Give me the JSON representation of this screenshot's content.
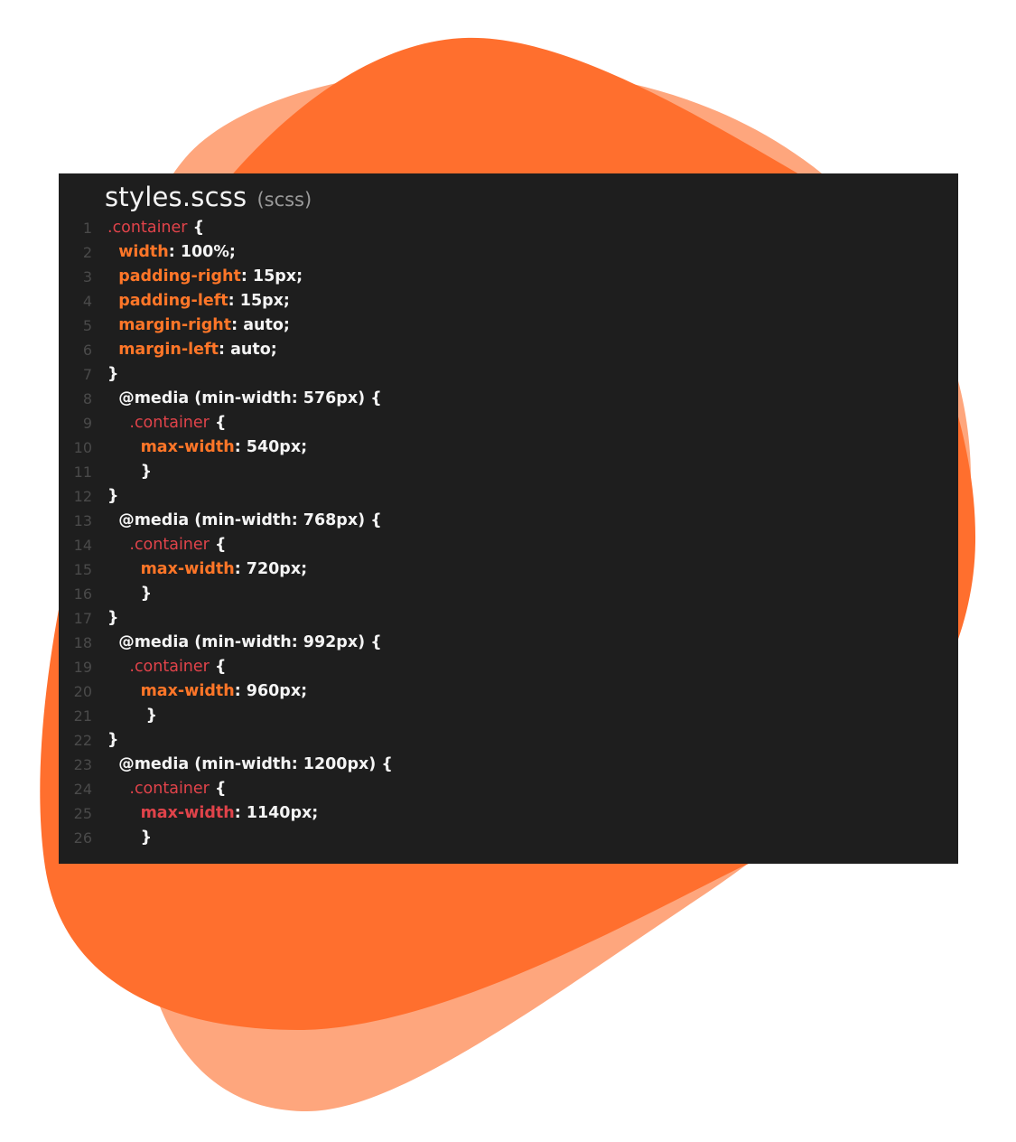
{
  "colors": {
    "blob_back": "#fea67d",
    "blob_front": "#ff6f2e",
    "editor_bg": "#1e1e1e",
    "selector": "#e0434a",
    "property": "#ff7628",
    "text": "#f4f4f4",
    "line_number": "#4a4a4a"
  },
  "editor": {
    "file_name": "styles.scss",
    "file_language": "(scss)",
    "lines": [
      {
        "num": "1",
        "indent": "",
        "tokens": [
          [
            "sel",
            ".container"
          ],
          [
            "punc",
            " {"
          ]
        ]
      },
      {
        "num": "2",
        "indent": " ",
        "tokens": [
          [
            "prop",
            "width"
          ],
          [
            "punc",
            ": "
          ],
          [
            "val",
            "100%;"
          ]
        ]
      },
      {
        "num": "3",
        "indent": " ",
        "tokens": [
          [
            "prop",
            "padding-right"
          ],
          [
            "punc",
            ": "
          ],
          [
            "val",
            "15px;"
          ]
        ]
      },
      {
        "num": "4",
        "indent": " ",
        "tokens": [
          [
            "prop",
            "padding-left"
          ],
          [
            "punc",
            ": "
          ],
          [
            "val",
            "15px;"
          ]
        ]
      },
      {
        "num": "5",
        "indent": " ",
        "tokens": [
          [
            "prop",
            "margin-right"
          ],
          [
            "punc",
            ": "
          ],
          [
            "val",
            "auto;"
          ]
        ]
      },
      {
        "num": "6",
        "indent": " ",
        "tokens": [
          [
            "prop",
            "margin-left"
          ],
          [
            "punc",
            ": "
          ],
          [
            "val",
            "auto;"
          ]
        ]
      },
      {
        "num": "7",
        "indent": "",
        "tokens": [
          [
            "punc",
            "}"
          ]
        ]
      },
      {
        "num": "8",
        "indent": " ",
        "tokens": [
          [
            "at",
            "@media (min-width: 576px) {"
          ]
        ]
      },
      {
        "num": "9",
        "indent": "  ",
        "tokens": [
          [
            "sel",
            ".container"
          ],
          [
            "punc",
            " {"
          ]
        ]
      },
      {
        "num": "10",
        "indent": "   ",
        "tokens": [
          [
            "prop",
            "max-width"
          ],
          [
            "punc",
            ": "
          ],
          [
            "val",
            "540px;"
          ]
        ]
      },
      {
        "num": "11",
        "indent": "   ",
        "tokens": [
          [
            "punc",
            "}"
          ]
        ]
      },
      {
        "num": "12",
        "indent": "",
        "tokens": [
          [
            "punc",
            "}"
          ]
        ]
      },
      {
        "num": "13",
        "indent": " ",
        "tokens": [
          [
            "at",
            "@media (min-width: 768px) {"
          ]
        ]
      },
      {
        "num": "14",
        "indent": "  ",
        "tokens": [
          [
            "sel",
            ".container"
          ],
          [
            "punc",
            " {"
          ]
        ]
      },
      {
        "num": "15",
        "indent": "   ",
        "tokens": [
          [
            "prop",
            "max-width"
          ],
          [
            "punc",
            ": "
          ],
          [
            "val",
            "720px;"
          ]
        ]
      },
      {
        "num": "16",
        "indent": "   ",
        "tokens": [
          [
            "punc",
            "}"
          ]
        ]
      },
      {
        "num": "17",
        "indent": "",
        "tokens": [
          [
            "punc",
            "}"
          ]
        ]
      },
      {
        "num": "18",
        "indent": " ",
        "tokens": [
          [
            "at",
            "@media (min-width: 992px) {"
          ]
        ]
      },
      {
        "num": "19",
        "indent": "  ",
        "tokens": [
          [
            "sel",
            ".container"
          ],
          [
            "punc",
            " {"
          ]
        ]
      },
      {
        "num": "20",
        "indent": "   ",
        "tokens": [
          [
            "prop",
            "max-width"
          ],
          [
            "punc",
            ": "
          ],
          [
            "val",
            "960px;"
          ]
        ]
      },
      {
        "num": "21",
        "indent": "   ",
        "tokens": [
          [
            "punc",
            " }"
          ]
        ]
      },
      {
        "num": "22",
        "indent": "",
        "tokens": [
          [
            "punc",
            "}"
          ]
        ]
      },
      {
        "num": "23",
        "indent": " ",
        "tokens": [
          [
            "at",
            "@media (min-width: 1200px) {"
          ]
        ]
      },
      {
        "num": "24",
        "indent": "  ",
        "tokens": [
          [
            "sel",
            ".container"
          ],
          [
            "punc",
            " {"
          ]
        ]
      },
      {
        "num": "25",
        "indent": "   ",
        "tokens": [
          [
            "red",
            "max-width"
          ],
          [
            "punc",
            ": "
          ],
          [
            "val",
            "1140px;"
          ]
        ]
      },
      {
        "num": "26",
        "indent": "   ",
        "tokens": [
          [
            "punc",
            "}"
          ]
        ]
      }
    ]
  }
}
